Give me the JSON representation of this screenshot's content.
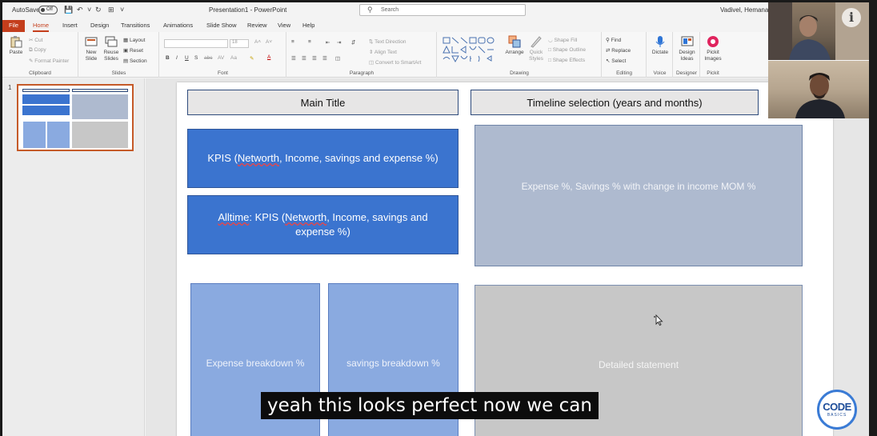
{
  "titlebar": {
    "autosave_label": "AutoSave",
    "autosave_state": "Off",
    "doc_title": "Presentation1  -  PowerPoint",
    "search_placeholder": "Search",
    "user": "Vadivel, Hemanand"
  },
  "tabs": [
    "File",
    "Home",
    "Insert",
    "Design",
    "Transitions",
    "Animations",
    "Slide Show",
    "Review",
    "View",
    "Help"
  ],
  "active_tab": "Home",
  "ribbon": {
    "clipboard": {
      "label": "Clipboard",
      "paste": "Paste",
      "cut": "Cut",
      "copy": "Copy",
      "format_painter": "Format Painter"
    },
    "slides": {
      "label": "Slides",
      "new_slide": "New Slide",
      "reuse_slides": "Reuse Slides",
      "layout": "Layout",
      "reset": "Reset",
      "section": "Section"
    },
    "font": {
      "label": "Font",
      "size": "18"
    },
    "paragraph": {
      "label": "Paragraph",
      "text_direction": "Text Direction",
      "align_text": "Align Text",
      "convert_smartart": "Convert to SmartArt"
    },
    "drawing": {
      "label": "Drawing",
      "arrange": "Arrange",
      "quick_styles": "Quick Styles",
      "shape_fill": "Shape Fill",
      "shape_outline": "Shape Outline",
      "shape_effects": "Shape Effects"
    },
    "editing": {
      "label": "Editing",
      "find": "Find",
      "replace": "Replace",
      "select": "Select"
    },
    "voice": {
      "label": "Voice",
      "dictate": "Dictate"
    },
    "designer": {
      "label": "Designer",
      "design_ideas": "Design Ideas"
    },
    "pickit": {
      "label": "Pickit",
      "pickit_images": "Pickit Images"
    }
  },
  "thumbnail": {
    "number": "1"
  },
  "slide": {
    "main_title": "Main Title",
    "timeline": "Timeline selection (years and months)",
    "kpis_prefix": "KPIS (",
    "kpis_networth": "Networth",
    "kpis_suffix": ", Income, savings and expense %)",
    "alltime_word": "Alltime",
    "alltime_prefix": ": KPIS (",
    "alltime_networth": "Networth",
    "alltime_suffix": ", Income, savings and expense %)",
    "expense_savings_mom": "Expense %, Savings % with change in income MOM %",
    "expense_breakdown": "Expense breakdown %",
    "savings_breakdown": "savings breakdown %",
    "detailed_statement": "Detailed statement"
  },
  "subtitle": "yeah this looks perfect now we can",
  "logo": {
    "line1": "CODE",
    "line2": "BASICS"
  }
}
